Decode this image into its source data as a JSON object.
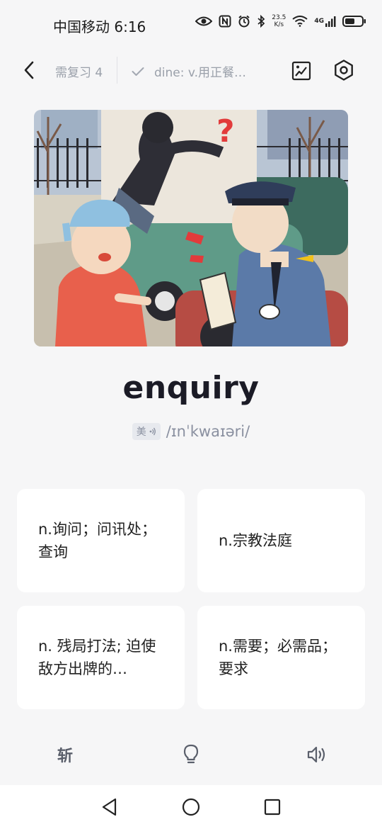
{
  "status_bar": {
    "carrier_time": "中国移动 6:16",
    "net_speed_value": "23.5",
    "net_speed_unit": "K/s",
    "network": "4G",
    "icons": [
      "eye-icon",
      "nfc-icon",
      "alarm-icon",
      "bluetooth-icon",
      "wifi-icon",
      "signal-icon",
      "battery-icon"
    ]
  },
  "nav": {
    "review_count": "需复习 4",
    "previous_word": "dine: v.用正餐…",
    "icons": [
      "back-icon",
      "check-icon",
      "image-icon",
      "settings-icon"
    ]
  },
  "card": {
    "word": "enquiry",
    "accent_label": "美",
    "phonetic": "/ɪnˈkwaɪəri/"
  },
  "options": [
    {
      "text": "n.询问；问讯处；查询"
    },
    {
      "text": "n.宗教法庭"
    },
    {
      "text": "n. 残局打法; 迫使敌方出牌的…"
    },
    {
      "text": "n.需要；必需品；要求"
    }
  ],
  "toolbar": {
    "chop_label": "斩",
    "icons": [
      "lightbulb-icon",
      "speaker-icon"
    ]
  },
  "system_nav": {
    "icons": [
      "nav-back-icon",
      "nav-home-icon",
      "nav-recents-icon"
    ]
  },
  "colors": {
    "background": "#f6f6f7",
    "card": "#ffffff",
    "text_primary": "#1b1b26",
    "text_muted": "#9aa0aa"
  }
}
